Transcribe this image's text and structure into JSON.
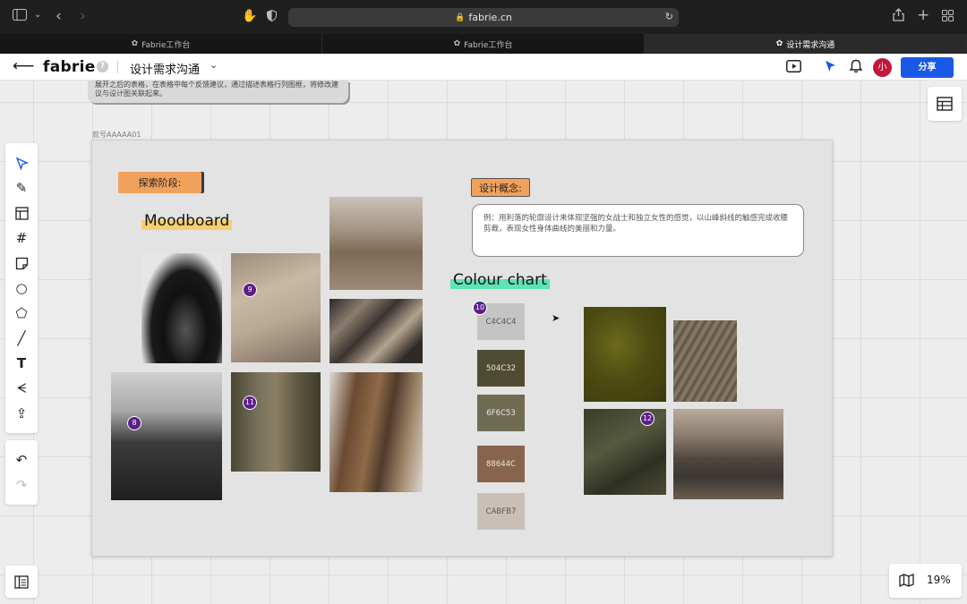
{
  "browser": {
    "url": "fabrie.cn",
    "tabs": [
      {
        "label": "Fabrie工作台",
        "active": false
      },
      {
        "label": "Fabrie工作台",
        "active": false
      },
      {
        "label": "设计需求沟通",
        "active": true
      }
    ],
    "icons": [
      "sidebar-toggle-icon",
      "back-icon",
      "forward-icon",
      "extension-hand-icon",
      "shield-icon",
      "lock-icon",
      "reload-icon",
      "share-icon",
      "new-tab-icon",
      "tab-overview-icon"
    ]
  },
  "header": {
    "logo": "fabrie",
    "help": "?",
    "doc_title": "设计需求沟通",
    "avatar_initial": "小",
    "share_label": "分享",
    "accent_color": "#1a58e6",
    "avatar_color": "#c4163a"
  },
  "canvas": {
    "note_text": "展开之后的表格，在表格中每个反馈建议，通过描述表格行列图框，将修改建议与设计图关联起来。",
    "frame_label": "款号AAAAA01",
    "explore_label": "探索阶段:",
    "moodboard_title": "Moodboard",
    "concept_label": "设计概念:",
    "concept_text": "例：用利落的轮廓设计来体现坚强的女战士和独立女性的感觉，以山峰斜线的触感完成收腰剪裁，表现女性身体曲线的美丽和力量。",
    "colour_chart_title": "Colour chart",
    "badges": [
      "9",
      "8",
      "11",
      "10",
      "12"
    ],
    "swatches": [
      {
        "hex": "C4C4C4",
        "color": "#c4c4c4",
        "text_color": "#555"
      },
      {
        "hex": "504C32",
        "color": "#504c32",
        "text_color": "#e6e6e6"
      },
      {
        "hex": "6F6C53",
        "color": "#6f6c53",
        "text_color": "#e6e6e6"
      },
      {
        "hex": "88644C",
        "color": "#88644c",
        "text_color": "#f0e6dc"
      },
      {
        "hex": "CABFB7",
        "color": "#cabfb7",
        "text_color": "#555"
      }
    ]
  },
  "toolbar": {
    "tools": [
      "select-tool",
      "pen-tool",
      "layout-tool",
      "frame-tool",
      "sticky-note-tool",
      "circle-tool",
      "polygon-tool",
      "line-tool",
      "text-tool",
      "mind-map-tool",
      "upload-tool"
    ],
    "history": [
      "undo",
      "redo"
    ]
  },
  "zoom": {
    "level": "19%"
  }
}
